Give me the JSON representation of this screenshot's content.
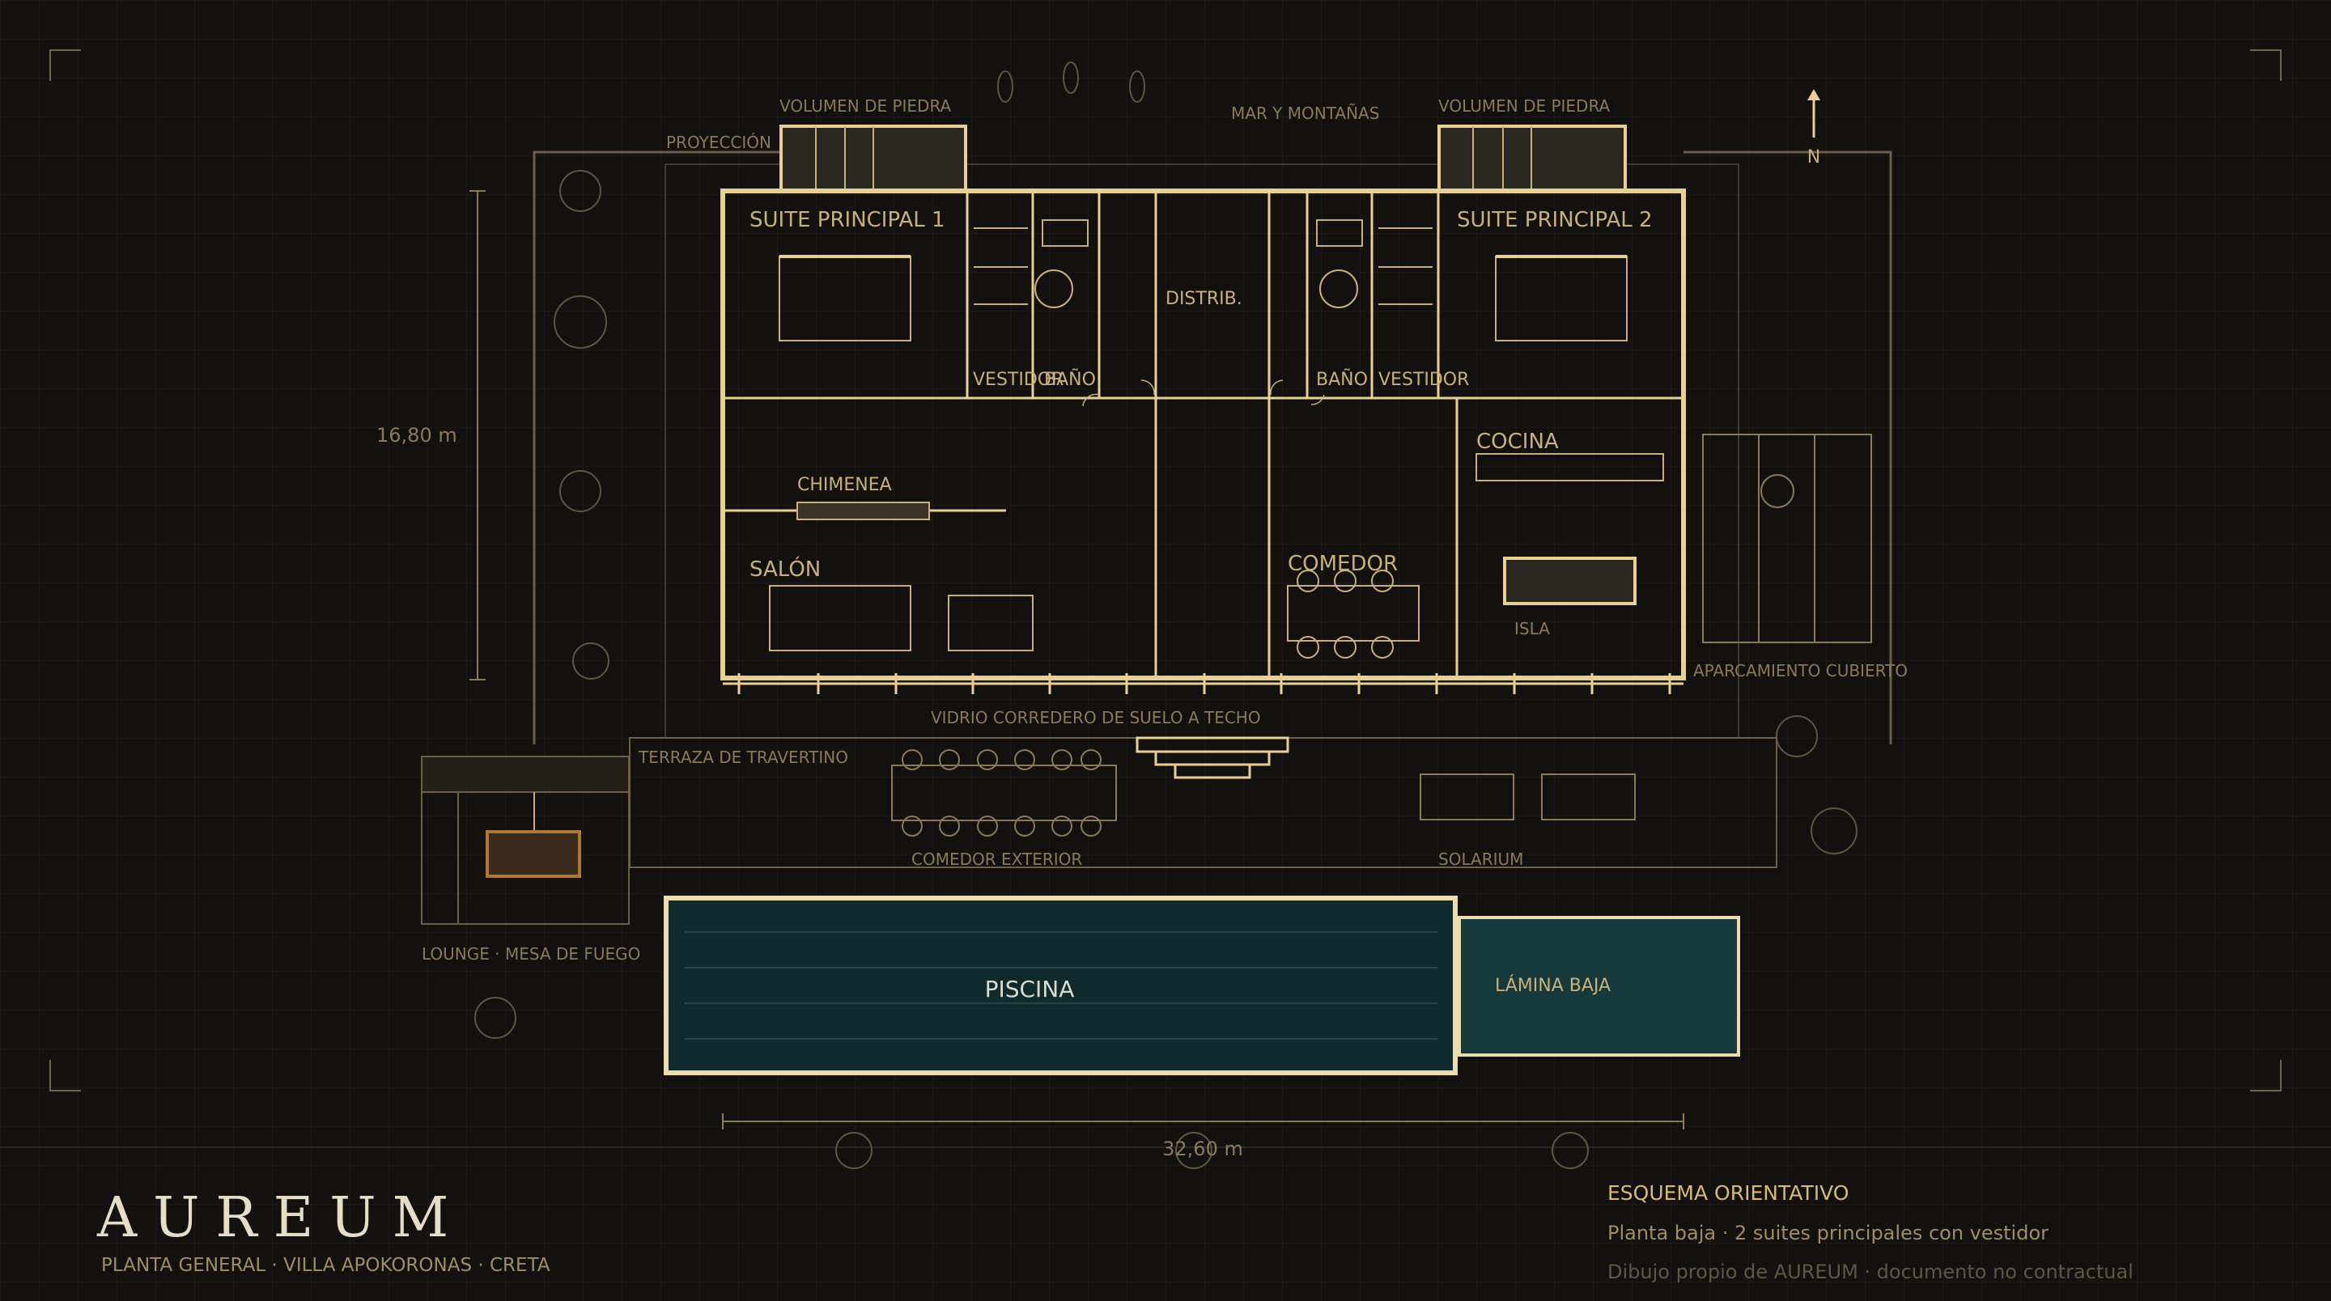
{
  "brand": {
    "name": "AUREUM",
    "subtitle": "PLANTA GENERAL · VILLA APOKORONAS · CRETA"
  },
  "info": {
    "heading": "ESQUEMA ORIENTATIVO",
    "line1": "Planta baja · 2 suites principales con vestidor",
    "line2": "Dibujo propio de AUREUM · documento no contractual"
  },
  "north": "N",
  "dimensions": {
    "depth": "16,80 m",
    "width": "32,60 m"
  },
  "labels": {
    "volumen_piedra_1": "VOLUMEN DE PIEDRA",
    "volumen_piedra_2": "VOLUMEN DE PIEDRA",
    "proyeccion": "PROYECCIÓN",
    "mar_montanas": "MAR Y MONTAÑAS",
    "suite_1": "SUITE PRINCIPAL 1",
    "suite_2": "SUITE PRINCIPAL 2",
    "vestidor_1": "VESTIDOR",
    "bano_1": "BAÑO",
    "distrib": "DISTRIB.",
    "bano_2": "BAÑO",
    "vestidor_2": "VESTIDOR",
    "cocina": "COCINA",
    "chimenea": "CHIMENEA",
    "salon": "SALÓN",
    "comedor": "COMEDOR",
    "isla": "ISLA",
    "aparcamiento": "APARCAMIENTO CUBIERTO",
    "vidrio": "VIDRIO CORREDERO DE SUELO A TECHO",
    "terraza": "TERRAZA DE TRAVERTINO",
    "comedor_exterior": "COMEDOR EXTERIOR",
    "solarium": "SOLARIUM",
    "lounge": "LOUNGE · MESA DE FUEGO",
    "piscina": "PISCINA",
    "lamina_baja": "LÁMINA BAJA"
  },
  "colors": {
    "background": "#121110",
    "gold": "#e8cf94",
    "gold_muted": "#8a7a58",
    "pool": "#112a2c",
    "shallow_pool": "#163a3c",
    "fire_accent": "#b0773a"
  }
}
